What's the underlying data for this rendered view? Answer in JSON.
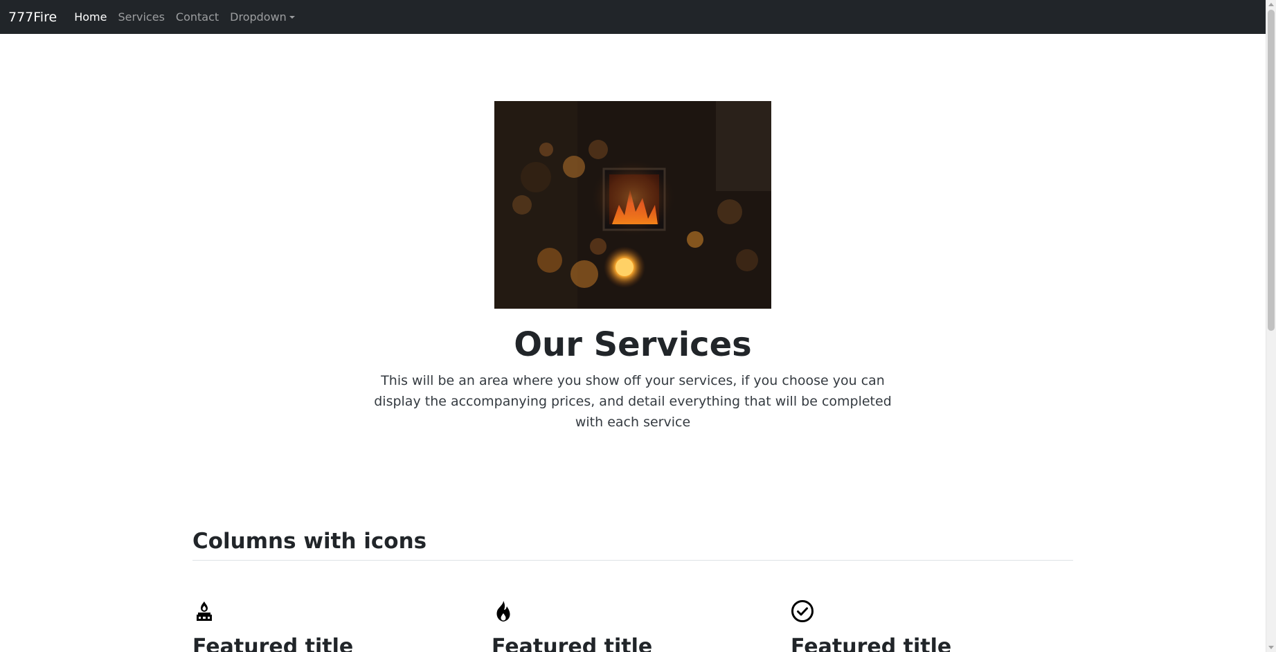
{
  "navbar": {
    "brand": "777Fire",
    "links": [
      {
        "label": "Home",
        "active": true
      },
      {
        "label": "Services",
        "active": false
      },
      {
        "label": "Contact",
        "active": false
      },
      {
        "label": "Dropdown",
        "active": false,
        "dropdown": true
      }
    ]
  },
  "hero": {
    "image_icon": "fireplace-photo",
    "title": "Our Services",
    "text": "This will be an area where you show off your services, if you choose you can display the accompanying prices, and detail everything that will be completed with each service"
  },
  "features_section": {
    "title": "Columns with icons",
    "features": [
      {
        "icon": "fireplace-icon",
        "title": "Featured title"
      },
      {
        "icon": "fire-icon",
        "title": "Featured title"
      },
      {
        "icon": "check-circle-icon",
        "title": "Featured title"
      }
    ]
  },
  "colors": {
    "navbar_bg": "#212529",
    "text": "#212529"
  }
}
